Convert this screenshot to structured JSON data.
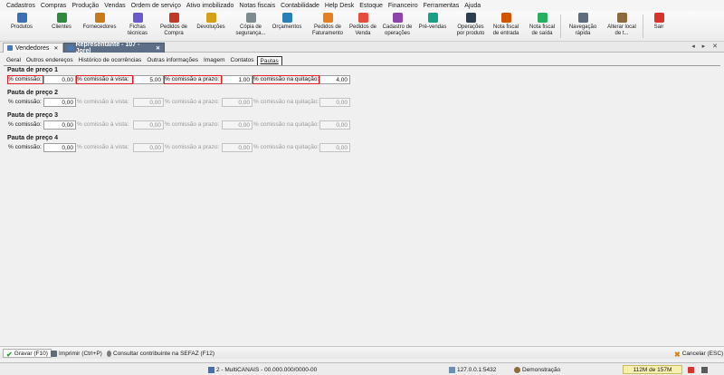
{
  "menu": [
    "Cadastros",
    "Compras",
    "Produção",
    "Vendas",
    "Ordem de serviço",
    "Ativo imobilizado",
    "Notas fiscais",
    "Contabilidade",
    "Help Desk",
    "Estoque",
    "Financeiro",
    "Ferramentas",
    "Ajuda"
  ],
  "toolbar": [
    {
      "label": "Produtos",
      "icon": "box-icon",
      "color": "#3b6fb6"
    },
    {
      "label": "Clientes",
      "icon": "user-icon",
      "color": "#2d8a3e"
    },
    {
      "label": "Fornecedores",
      "icon": "truck-icon",
      "color": "#c87a1a"
    },
    {
      "label": "Fichas\ntécnicas",
      "icon": "sheet-icon",
      "color": "#6a5acd"
    },
    {
      "label": "Pedidos de\nCompra",
      "icon": "cart-icon",
      "color": "#c0392b"
    },
    {
      "label": "Devoluções",
      "icon": "return-icon",
      "color": "#d4a017"
    },
    {
      "label": "Cópia de\nsegurança...",
      "icon": "backup-icon",
      "color": "#7f8c8d"
    },
    {
      "label": "Orçamentos",
      "icon": "calculator-icon",
      "color": "#2980b9"
    },
    {
      "label": "Pedidos de\nFaturamento",
      "icon": "invoice-icon",
      "color": "#e67e22"
    },
    {
      "label": "Pedidos de\nVenda",
      "icon": "sales-icon",
      "color": "#e74c3c"
    },
    {
      "label": "Cadastro de\noperações",
      "icon": "gears-icon",
      "color": "#8e44ad"
    },
    {
      "label": "Pré-vendas",
      "icon": "presale-icon",
      "color": "#16a085"
    },
    {
      "label": "Operações\npor produto",
      "icon": "ops-icon",
      "color": "#2c3e50"
    },
    {
      "label": "Nota fiscal\nde entrada",
      "icon": "note-in-icon",
      "color": "#d35400"
    },
    {
      "label": "Nota fiscal\nde saída",
      "icon": "note-out-icon",
      "color": "#27ae60"
    },
    {
      "label": "Navegação\nrápida",
      "icon": "people-icon",
      "color": "#5d6d7e"
    },
    {
      "label": "Alterar local\nde t...",
      "icon": "home-icon",
      "color": "#8b6b3d"
    },
    {
      "label": "Sair",
      "icon": "power-icon",
      "color": "#d9342b"
    }
  ],
  "doctabs": [
    {
      "label": "Vendedores",
      "active": false
    },
    {
      "label": "Representante - 107 - Jorel",
      "active": true
    }
  ],
  "subtabs": [
    {
      "label": "Geral",
      "active": false
    },
    {
      "label": "Outros endereços",
      "active": false
    },
    {
      "label": "Histórico de ocorrências",
      "active": false
    },
    {
      "label": "Outras informações",
      "active": false
    },
    {
      "label": "Imagem",
      "active": false
    },
    {
      "label": "Contatos",
      "active": false
    },
    {
      "label": "Pautas",
      "active": true
    }
  ],
  "groups": [
    {
      "title": "Pauta de preço 1",
      "comissao": "0,00",
      "vista": "5,00",
      "prazo": "1,00",
      "quitacao": "4,00",
      "enabled": true
    },
    {
      "title": "Pauta de preço 2",
      "comissao": "0,00",
      "vista": "0,00",
      "prazo": "0,00",
      "quitacao": "0,00",
      "enabled": false
    },
    {
      "title": "Pauta de preço 3",
      "comissao": "0,00",
      "vista": "0,00",
      "prazo": "0,00",
      "quitacao": "0,00",
      "enabled": false
    },
    {
      "title": "Pauta de preço 4",
      "comissao": "0,00",
      "vista": "0,00",
      "prazo": "0,00",
      "quitacao": "0,00",
      "enabled": false
    }
  ],
  "field_labels": {
    "comissao": "% comissão:",
    "vista": "% comissão à vista:",
    "prazo": "% comissão a prazo:",
    "quitacao": "% comissão na quitação:"
  },
  "bottom": {
    "save": "Gravar (F10)",
    "print": "Imprimir (Ctrl+P)",
    "consult": "Consultar contribuinte na SEFAZ (F12)",
    "cancel": "Cancelar (ESC)"
  },
  "status": {
    "company": "2 - MultiCANAIS - 00.000.000/0000-00",
    "server": "127.0.0.1:5432",
    "user": "Demonstração",
    "memory": "112M de 157M"
  },
  "nav_arrows": "◂ ▸ ✕"
}
